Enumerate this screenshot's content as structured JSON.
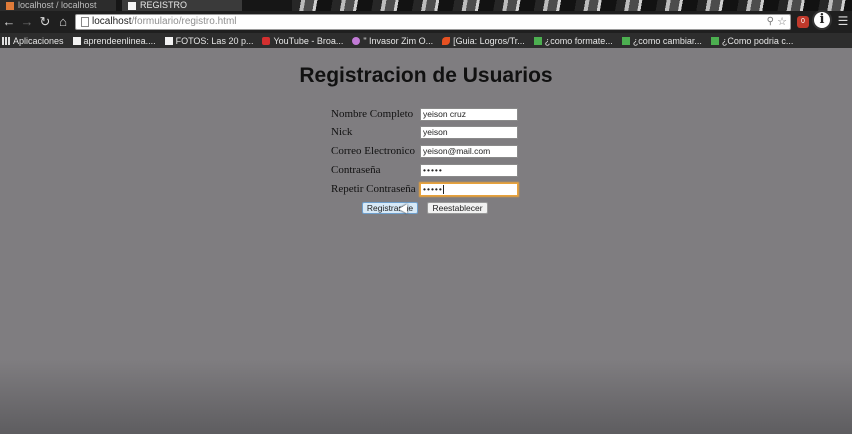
{
  "browser": {
    "tabs": [
      {
        "label": "localhost / localhost",
        "active": false
      },
      {
        "label": "REGISTRO",
        "active": true
      }
    ],
    "url": {
      "host": "localhost",
      "path": "/formulario/registro.html"
    },
    "ext_badge": "0",
    "info_glyph": "i",
    "bookmarks": [
      {
        "label": "Aplicaciones",
        "icon": "apps-icon"
      },
      {
        "label": "aprendeenlinea....",
        "icon": "page-icon"
      },
      {
        "label": "FOTOS: Las 20 p...",
        "icon": "page-icon"
      },
      {
        "label": "YouTube - Broa...",
        "icon": "youtube-icon"
      },
      {
        "label": "\" Invasor Zim O...",
        "icon": "zim-icon"
      },
      {
        "label": "[Guia: Logros/Tr...",
        "icon": "guia-icon"
      },
      {
        "label": "¿como formate...",
        "icon": "green-icon"
      },
      {
        "label": "¿como cambiar...",
        "icon": "green-icon"
      },
      {
        "label": "¿Como podria c...",
        "icon": "green-icon"
      }
    ]
  },
  "page": {
    "title": "Registracion de Usuarios",
    "fields": [
      {
        "label": "Nombre Completo",
        "value": "yeison cruz"
      },
      {
        "label": "Nick",
        "value": "yeison"
      },
      {
        "label": "Correo Electronico",
        "value": "yeison@mail.com"
      },
      {
        "label": "Contraseña",
        "value": "•••••"
      },
      {
        "label": "Repetir Contraseña",
        "value": "•••••"
      }
    ],
    "submit_label": "Registrarme",
    "reset_label": "Reestablecer"
  },
  "colors": {
    "page_background": "#7f7d80",
    "focus_outline": "#e8a23b",
    "submit_background": "#d7e9f7"
  }
}
